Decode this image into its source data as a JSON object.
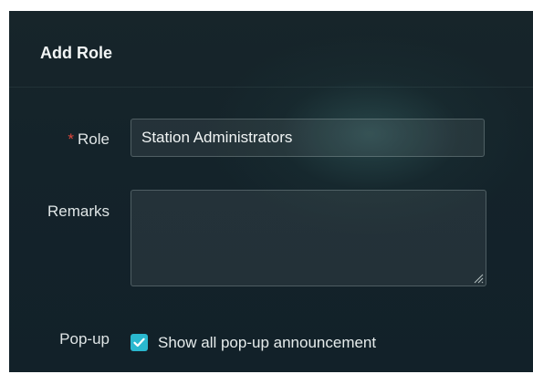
{
  "dialog": {
    "title": "Add Role"
  },
  "form": {
    "role": {
      "required_marker": "*",
      "label": "Role",
      "value": "Station Administrators"
    },
    "remarks": {
      "label": "Remarks",
      "value": ""
    },
    "popup": {
      "label": "Pop-up",
      "checked": true,
      "checkbox_label": "Show all pop-up announcement"
    }
  },
  "colors": {
    "background": "#14232a",
    "accent": "#2ab8cf",
    "required": "#e0473c"
  },
  "icons": {
    "checkbox": "checkmark-icon",
    "resize": "resize-grip-icon"
  }
}
